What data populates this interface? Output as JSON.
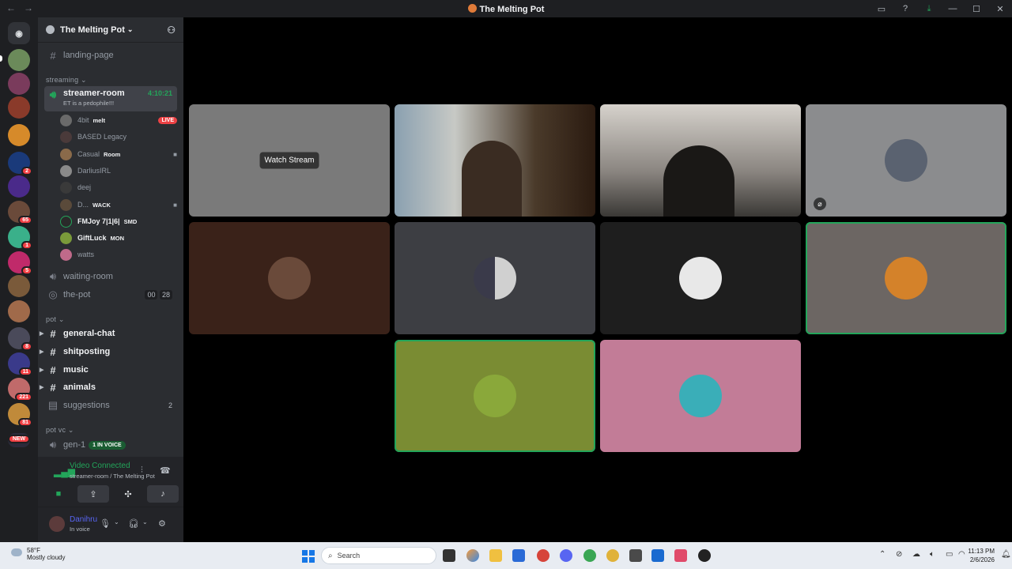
{
  "window": {
    "title": "The Melting Pot",
    "controls": [
      "inbox-icon",
      "help-icon",
      "download-icon",
      "minimize",
      "maximize",
      "close"
    ]
  },
  "guilds": {
    "badges": [
      "2",
      "65",
      "1",
      "5",
      "8",
      "11",
      "221",
      "81",
      "NEW"
    ]
  },
  "server": {
    "name": "The Melting Pot"
  },
  "channels": {
    "landing": "landing-page",
    "category_streaming": "streaming",
    "streamer_room": "streamer-room",
    "streamer_room_timer": "4:10:21",
    "streamer_room_status": "ET is a pedophile!!!",
    "waiting_room": "waiting-room",
    "the_pot": "the-pot",
    "the_pot_count_a": "00",
    "the_pot_count_b": "28",
    "category_pot": "pot",
    "general_chat": "general-chat",
    "shitposting": "shitposting",
    "music": "music",
    "animals": "animals",
    "suggestions": "suggestions",
    "suggestions_count": "2",
    "category_potvc": "pot vc",
    "gen": "gen-1",
    "gen_voice_badge": "1 IN VOICE"
  },
  "voice_users": [
    {
      "name": "4bit",
      "tag": "melt",
      "badge": "LIVE"
    },
    {
      "name": "BASED Legacy",
      "tag": ""
    },
    {
      "name": "Casual",
      "tag": "Room"
    },
    {
      "name": "DarliusIRL",
      "tag": ""
    },
    {
      "name": "deej",
      "tag": ""
    },
    {
      "name": "D...",
      "tag": "WACK"
    },
    {
      "name": "FMJoy 7|1|6|",
      "tag": "SMD"
    },
    {
      "name": "GiftLuck",
      "tag": "MON"
    },
    {
      "name": "watts",
      "tag": ""
    }
  ],
  "rtc": {
    "status": "Video Connected",
    "location": "streamer-room / The Melting Pot"
  },
  "user": {
    "name": "Danihru",
    "state": "In voice"
  },
  "stage": {
    "watch_label": "Watch Stream"
  },
  "taskbar": {
    "temp": "58°F",
    "condition": "Mostly cloudy",
    "search_placeholder": "Search",
    "time": "11:13 PM",
    "date": "2/6/2026"
  }
}
